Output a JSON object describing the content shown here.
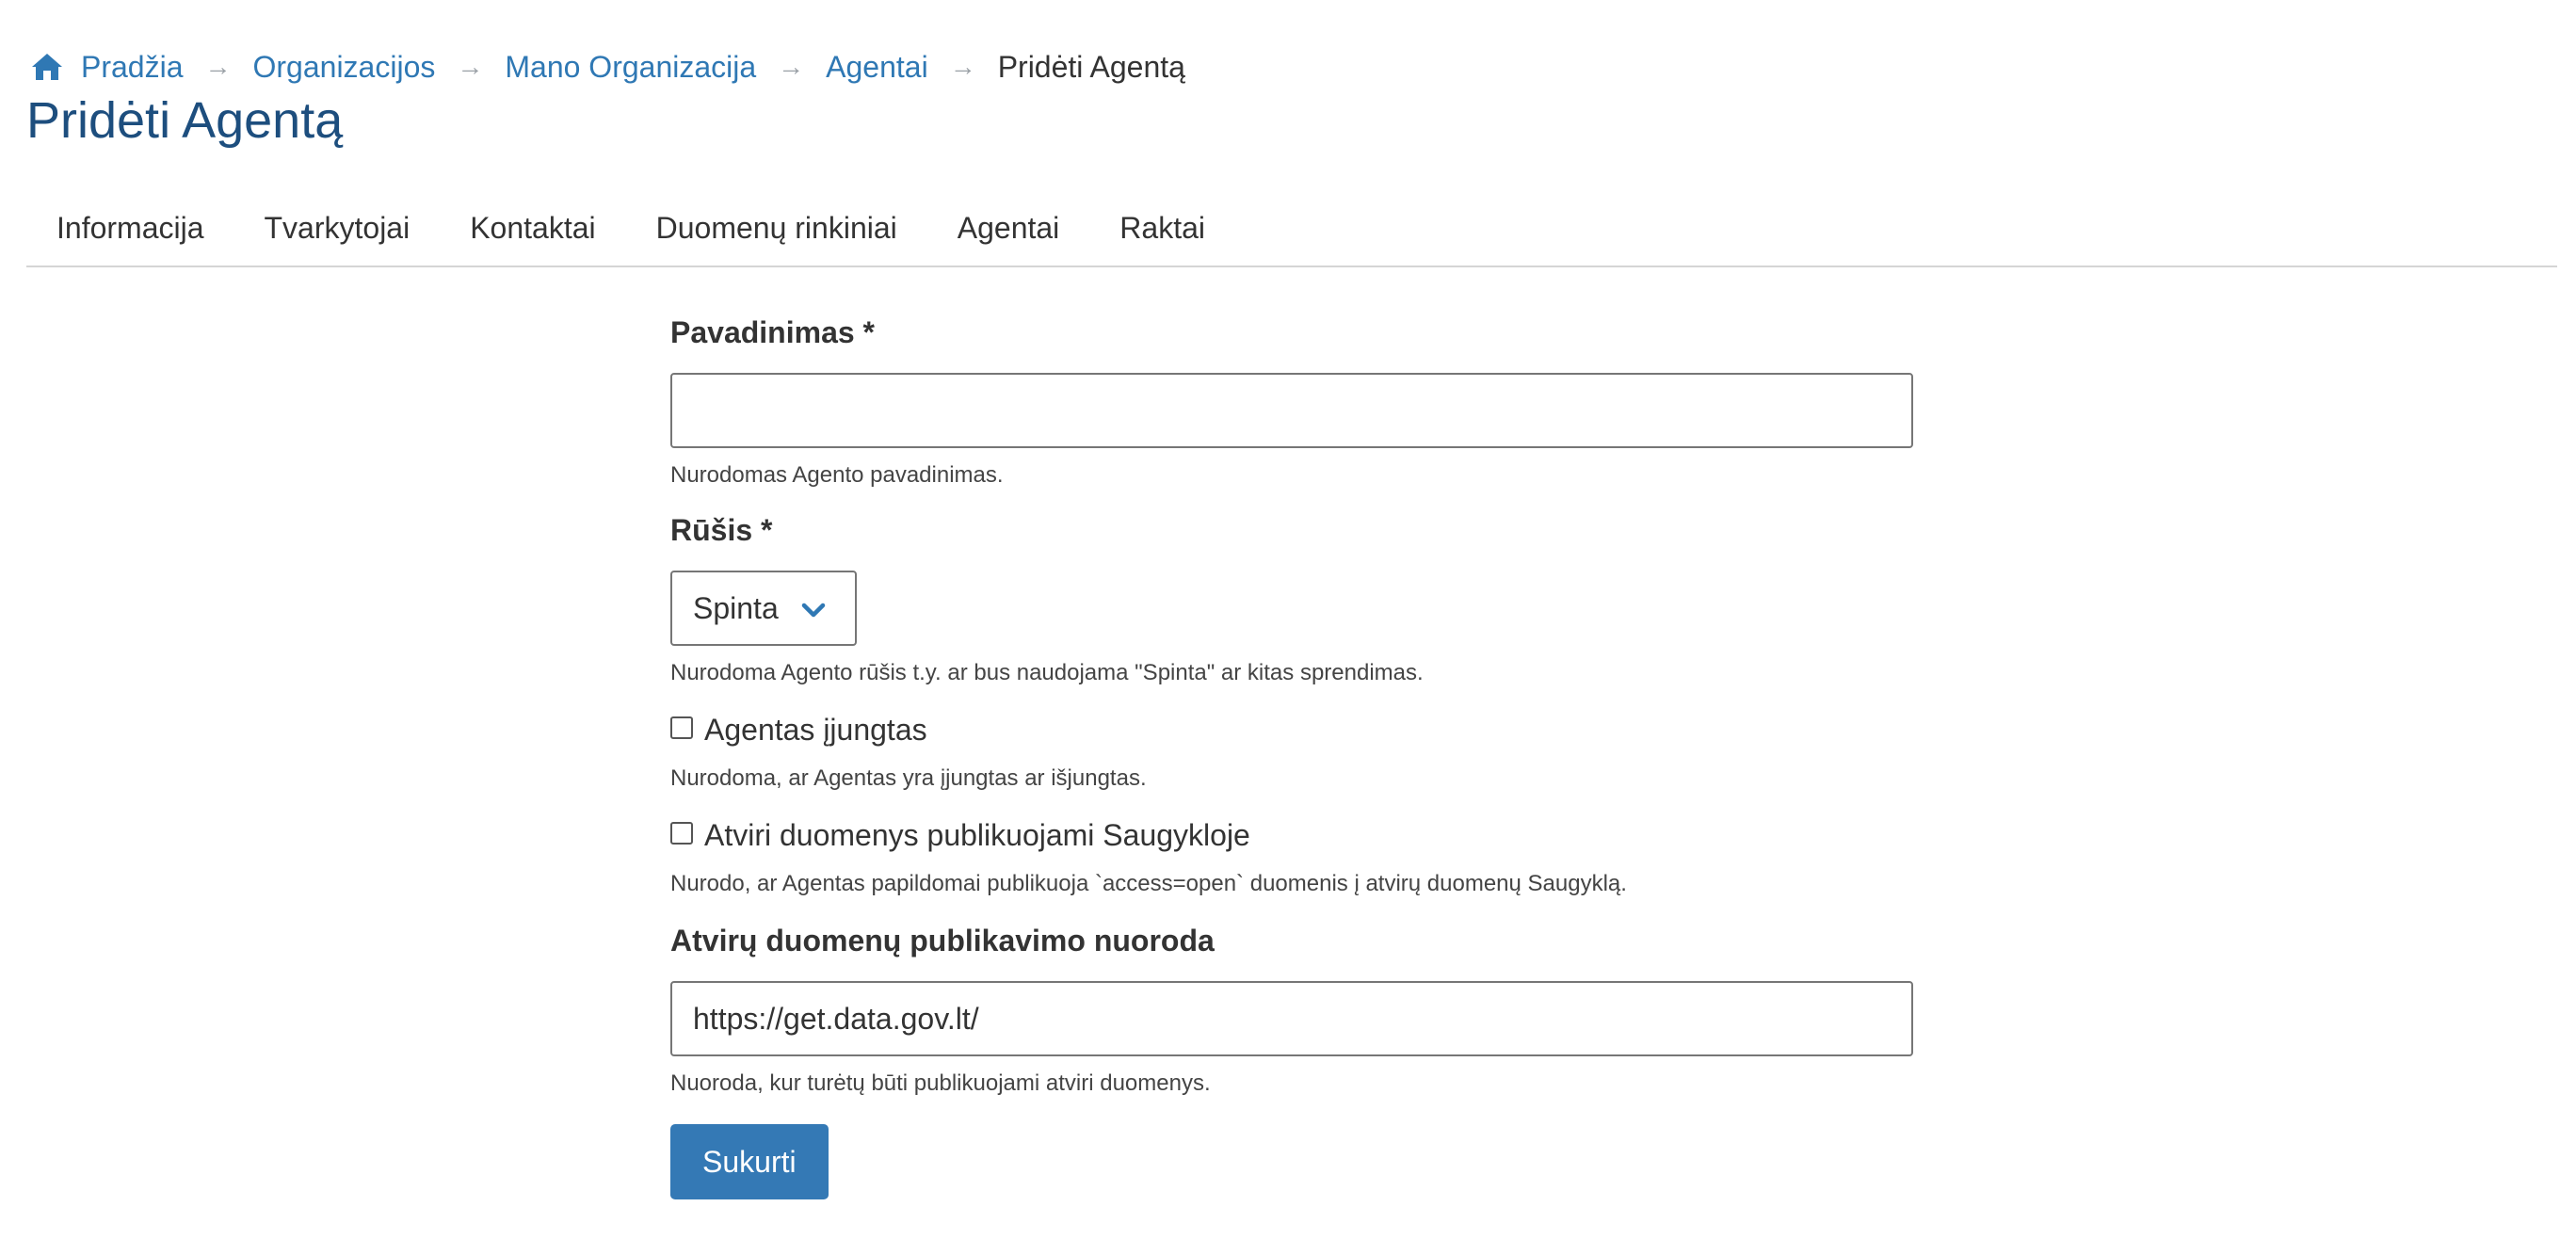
{
  "breadcrumb": {
    "home": "Pradžia",
    "organizations": "Organizacijos",
    "my_org": "Mano Organizacija",
    "agents": "Agentai",
    "current": "Pridėti Agentą",
    "separator": "→"
  },
  "page": {
    "title": "Pridėti Agentą"
  },
  "tabs": [
    {
      "label": "Informacija"
    },
    {
      "label": "Tvarkytojai"
    },
    {
      "label": "Kontaktai"
    },
    {
      "label": "Duomenų rinkiniai"
    },
    {
      "label": "Agentai"
    },
    {
      "label": "Raktai"
    }
  ],
  "form": {
    "name": {
      "label": "Pavadinimas *",
      "value": "",
      "help": "Nurodomas Agento pavadinimas."
    },
    "type": {
      "label": "Rūšis *",
      "selected": "Spinta",
      "help": "Nurodoma Agento rūšis t.y. ar bus naudojama \"Spinta\" ar kitas sprendimas."
    },
    "enabled": {
      "label": "Agentas įjungtas",
      "checked": false,
      "help": "Nurodoma, ar Agentas yra įjungtas ar išjungtas."
    },
    "open_data": {
      "label": "Atviri duomenys publikuojami Saugykloje",
      "checked": false,
      "help": "Nurodo, ar Agentas papildomai publikuoja `access=open` duomenis į atvirų duomenų Saugyklą."
    },
    "publish_url": {
      "label": "Atvirų duomenų publikavimo nuoroda",
      "value": "https://get.data.gov.lt/",
      "help": "Nuoroda, kur turėtų būti publikuojami atviri duomenys."
    },
    "submit_label": "Sukurti"
  },
  "colors": {
    "link": "#2f78b4",
    "title": "#1d4e7e",
    "button": "#3479b5"
  }
}
